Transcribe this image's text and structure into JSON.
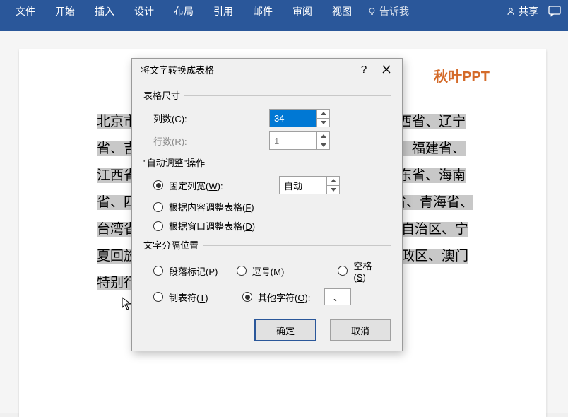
{
  "ribbon": {
    "tabs": [
      "文件",
      "开始",
      "插入",
      "设计",
      "布局",
      "引用",
      "邮件",
      "审阅",
      "视图"
    ],
    "tell_me": "告诉我",
    "share": "共享"
  },
  "page": {
    "title_right": "秋叶PPT",
    "lines": [
      {
        "left": "北京市",
        "right": "西省、辽宁"
      },
      {
        "left": "省、吉",
        "right": "、福建省、"
      },
      {
        "left": "江西省",
        "right": "东省、海南"
      },
      {
        "left": "省、四",
        "right": "省、青海省、"
      },
      {
        "left": "台湾省",
        "right": "自治区、宁"
      },
      {
        "left": "夏回族",
        "right": "政区、澳门"
      },
      {
        "left": "特别行",
        "right": ""
      }
    ]
  },
  "dialog": {
    "title": "将文字转换成表格",
    "group_size": "表格尺寸",
    "cols_label": "列数(C):",
    "cols_value": "34",
    "rows_label": "行数(R):",
    "rows_value": "1",
    "group_autofit": "\"自动调整\"操作",
    "fixed_width": "固定列宽(W):",
    "fixed_width_value": "自动",
    "autofit_content": "根据内容调整表格(F)",
    "autofit_window": "根据窗口调整表格(D)",
    "group_sep": "文字分隔位置",
    "sep_paragraph": "段落标记(P)",
    "sep_comma": "逗号(M)",
    "sep_space": "空格(S)",
    "sep_tab": "制表符(T)",
    "sep_other": "其他字符(O):",
    "sep_char": "、",
    "ok": "确定",
    "cancel": "取消"
  }
}
